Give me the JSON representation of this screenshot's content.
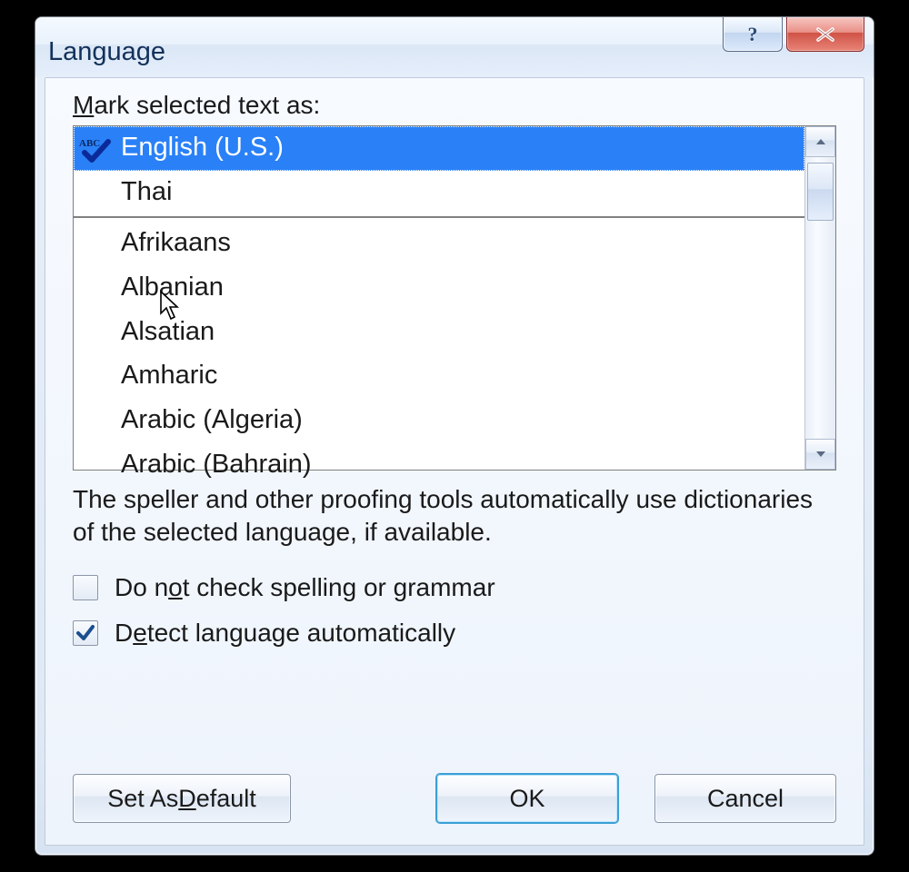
{
  "window": {
    "title": "Language"
  },
  "label_prefix": "M",
  "label_rest": "ark selected text as:",
  "languages": [
    {
      "name": "English (U.S.)",
      "selected": true,
      "has_spellcheck": true
    },
    {
      "name": "Thai"
    },
    {
      "sep": true
    },
    {
      "name": "Afrikaans"
    },
    {
      "name": "Albanian"
    },
    {
      "name": "Alsatian"
    },
    {
      "name": "Amharic"
    },
    {
      "name": "Arabic (Algeria)"
    },
    {
      "name": "Arabic (Bahrain)"
    }
  ],
  "description": "The speller and other proofing tools automatically use dictionaries of the selected language, if available.",
  "checkbox1": {
    "pre": "Do n",
    "u": "o",
    "post": "t check spelling or grammar",
    "checked": false
  },
  "checkbox2": {
    "pre": "D",
    "u": "e",
    "post": "tect language automatically",
    "checked": true
  },
  "buttons": {
    "set_default_pre": "Set As ",
    "set_default_u": "D",
    "set_default_post": "efault",
    "ok": "OK",
    "cancel": "Cancel"
  }
}
